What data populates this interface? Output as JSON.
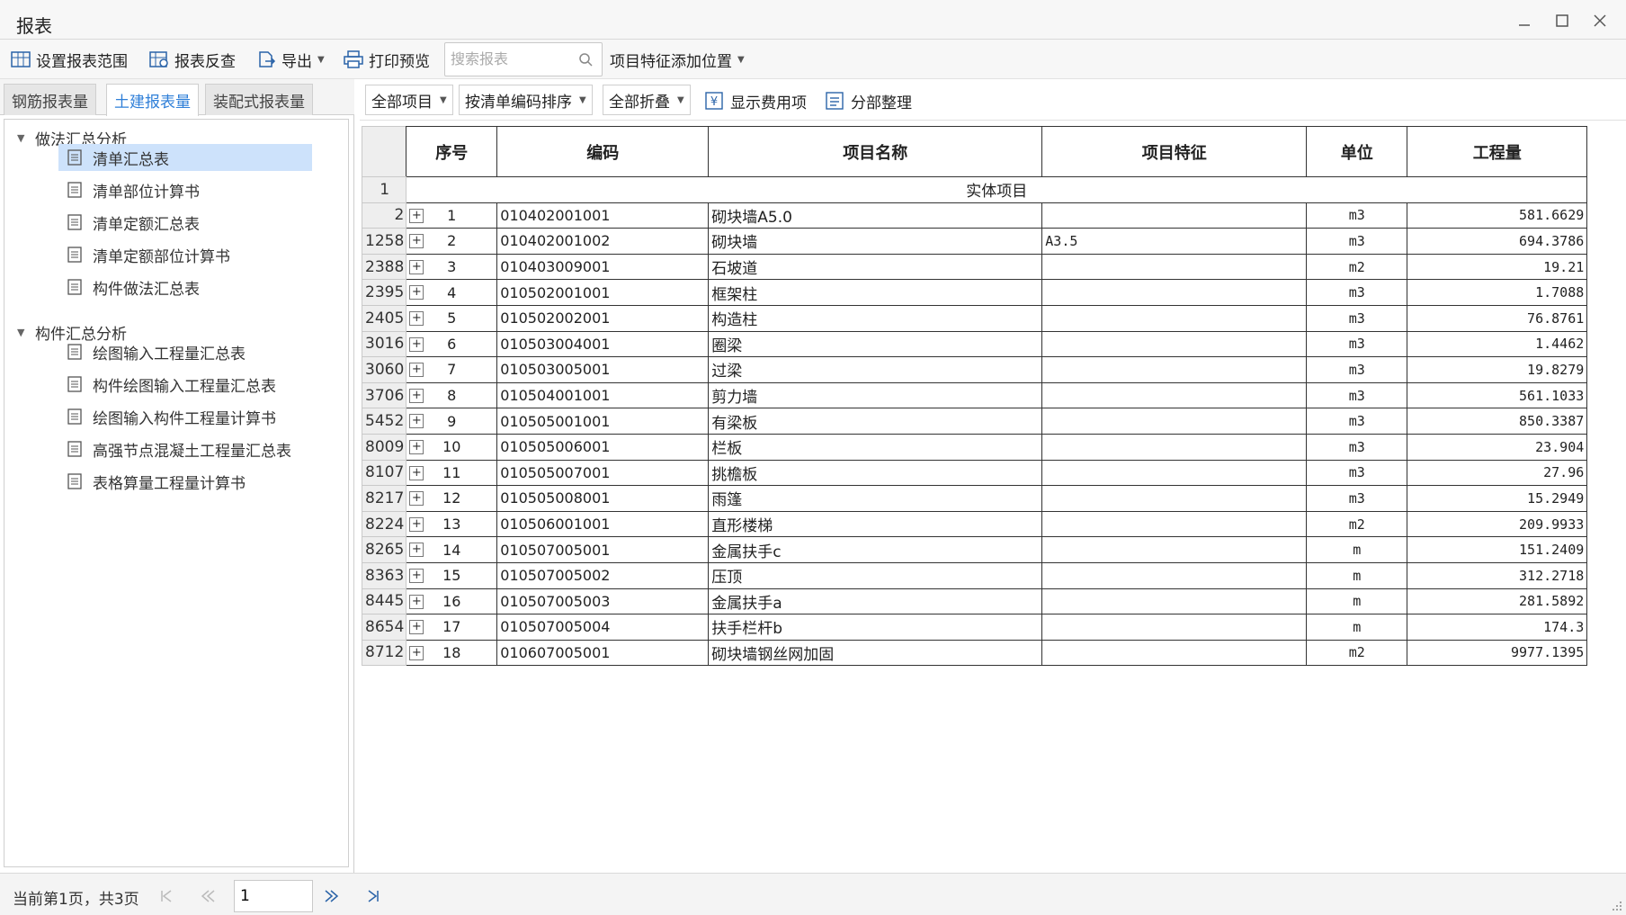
{
  "window": {
    "title": "报表"
  },
  "toolbar": {
    "set_range": "设置报表范围",
    "report_check": "报表反查",
    "export": "导出",
    "print_preview": "打印预览",
    "search_placeholder": "搜索报表",
    "feature_position": "项目特征添加位置"
  },
  "tabs": [
    "钢筋报表量",
    "土建报表量",
    "装配式报表量"
  ],
  "active_tab": 1,
  "tree": {
    "group1": "做法汇总分析",
    "group1_items": [
      "清单汇总表",
      "清单部位计算书",
      "清单定额汇总表",
      "清单定额部位计算书",
      "构件做法汇总表"
    ],
    "group2": "构件汇总分析",
    "group2_items": [
      "绘图输入工程量汇总表",
      "构件绘图输入工程量汇总表",
      "绘图输入构件工程量计算书",
      "高强节点混凝土工程量汇总表",
      "表格算量工程量计算书"
    ]
  },
  "filters": {
    "all_items": "全部项目",
    "sort": "按清单编码排序",
    "collapse": "全部折叠",
    "show_fee": "显示费用项",
    "sub_arrange": "分部整理"
  },
  "table": {
    "headers": [
      "序号",
      "编码",
      "项目名称",
      "项目特征",
      "单位",
      "工程量"
    ],
    "section_row_no": "1",
    "section_label": "实体项目",
    "rows": [
      {
        "rn": "2",
        "seq": "1",
        "code": "010402001001",
        "name": "砌块墙A5.0",
        "feature": "",
        "unit": "m3",
        "qty": "581.6629"
      },
      {
        "rn": "1258",
        "seq": "2",
        "code": "010402001002",
        "name": "砌块墙",
        "feature": "A3.5",
        "unit": "m3",
        "qty": "694.3786"
      },
      {
        "rn": "2388",
        "seq": "3",
        "code": "010403009001",
        "name": "石坡道",
        "feature": "",
        "unit": "m2",
        "qty": "19.21"
      },
      {
        "rn": "2395",
        "seq": "4",
        "code": "010502001001",
        "name": "框架柱",
        "feature": "",
        "unit": "m3",
        "qty": "1.7088"
      },
      {
        "rn": "2405",
        "seq": "5",
        "code": "010502002001",
        "name": "构造柱",
        "feature": "",
        "unit": "m3",
        "qty": "76.8761"
      },
      {
        "rn": "3016",
        "seq": "6",
        "code": "010503004001",
        "name": "圈梁",
        "feature": "",
        "unit": "m3",
        "qty": "1.4462"
      },
      {
        "rn": "3060",
        "seq": "7",
        "code": "010503005001",
        "name": "过梁",
        "feature": "",
        "unit": "m3",
        "qty": "19.8279"
      },
      {
        "rn": "3706",
        "seq": "8",
        "code": "010504001001",
        "name": "剪力墙",
        "feature": "",
        "unit": "m3",
        "qty": "561.1033"
      },
      {
        "rn": "5452",
        "seq": "9",
        "code": "010505001001",
        "name": "有梁板",
        "feature": "",
        "unit": "m3",
        "qty": "850.3387"
      },
      {
        "rn": "8009",
        "seq": "10",
        "code": "010505006001",
        "name": "栏板",
        "feature": "",
        "unit": "m3",
        "qty": "23.904"
      },
      {
        "rn": "8107",
        "seq": "11",
        "code": "010505007001",
        "name": "挑檐板",
        "feature": "",
        "unit": "m3",
        "qty": "27.96"
      },
      {
        "rn": "8217",
        "seq": "12",
        "code": "010505008001",
        "name": "雨篷",
        "feature": "",
        "unit": "m3",
        "qty": "15.2949"
      },
      {
        "rn": "8224",
        "seq": "13",
        "code": "010506001001",
        "name": "直形楼梯",
        "feature": "",
        "unit": "m2",
        "qty": "209.9933"
      },
      {
        "rn": "8265",
        "seq": "14",
        "code": "010507005001",
        "name": "金属扶手c",
        "feature": "",
        "unit": "m",
        "qty": "151.2409"
      },
      {
        "rn": "8363",
        "seq": "15",
        "code": "010507005002",
        "name": "压顶",
        "feature": "",
        "unit": "m",
        "qty": "312.2718"
      },
      {
        "rn": "8445",
        "seq": "16",
        "code": "010507005003",
        "name": "金属扶手a",
        "feature": "",
        "unit": "m",
        "qty": "281.5892"
      },
      {
        "rn": "8654",
        "seq": "17",
        "code": "010507005004",
        "name": "扶手栏杆b",
        "feature": "",
        "unit": "m",
        "qty": "174.3"
      },
      {
        "rn": "8712",
        "seq": "18",
        "code": "010607005001",
        "name": "砌块墙钢丝网加固",
        "feature": "",
        "unit": "m2",
        "qty": "9977.1395"
      }
    ]
  },
  "status": {
    "page_info": "当前第1页，共3页",
    "page_value": "1"
  },
  "colors": {
    "accent": "#2f7fd8",
    "selected_bg": "#cde2fb",
    "row_header_bg": "#eeeeee"
  }
}
